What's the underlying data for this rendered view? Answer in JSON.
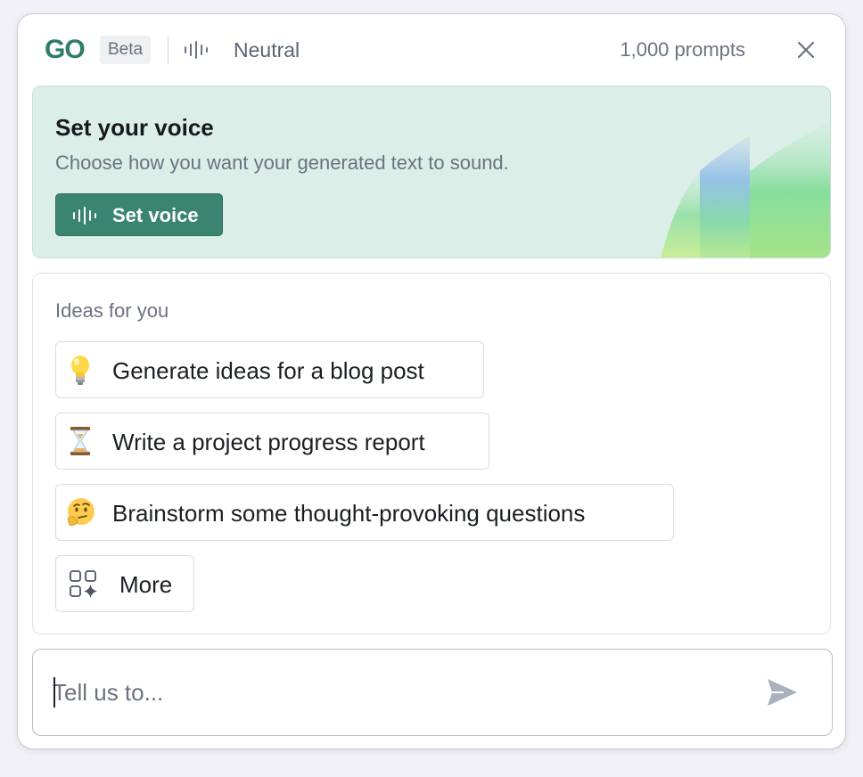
{
  "header": {
    "logo": "GO",
    "beta_label": "Beta",
    "voice_name": "Neutral",
    "prompt_count": "1,000 prompts",
    "icons": [
      "voice-wave-icon",
      "close-icon"
    ]
  },
  "banner": {
    "title": "Set your voice",
    "subtitle": "Choose how you want your generated text to sound.",
    "button_label": "Set voice",
    "button_icon": "voice-wave-icon",
    "colors": {
      "background": "#dceee8",
      "button": "#3b8570"
    }
  },
  "ideas": {
    "title": "Ideas for you",
    "items": [
      {
        "icon": "lightbulb-icon",
        "label": "Generate ideas for a blog post"
      },
      {
        "icon": "hourglass-icon",
        "label": "Write a project progress report"
      },
      {
        "icon": "thinking-face-icon",
        "label": "Brainstorm some thought-provoking questions"
      },
      {
        "icon": "grid-sparkle-icon",
        "label": "More"
      }
    ]
  },
  "input": {
    "placeholder": "Tell us to...",
    "value": "",
    "send_icon": "send-icon"
  },
  "colors": {
    "brand": "#2f7d68"
  }
}
